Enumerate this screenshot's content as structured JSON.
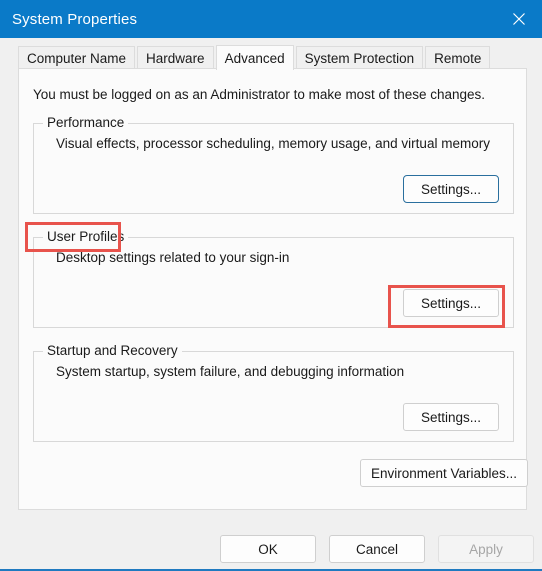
{
  "window": {
    "title": "System Properties",
    "close_icon": "close-icon"
  },
  "tabs": [
    {
      "label": "Computer Name",
      "active": false
    },
    {
      "label": "Hardware",
      "active": false
    },
    {
      "label": "Advanced",
      "active": true
    },
    {
      "label": "System Protection",
      "active": false
    },
    {
      "label": "Remote",
      "active": false
    }
  ],
  "main": {
    "admin_note": "You must be logged on as an Administrator to make most of these changes.",
    "groups": [
      {
        "legend": "Performance",
        "description": "Visual effects, processor scheduling, memory usage, and virtual memory",
        "button_label": "Settings..."
      },
      {
        "legend": "User Profiles",
        "description": "Desktop settings related to your sign-in",
        "button_label": "Settings..."
      },
      {
        "legend": "Startup and Recovery",
        "description": "System startup, system failure, and debugging information",
        "button_label": "Settings..."
      }
    ],
    "environment_variables_label": "Environment Variables..."
  },
  "footer": {
    "ok_label": "OK",
    "cancel_label": "Cancel",
    "apply_label": "Apply"
  },
  "colors": {
    "titlebar": "#0a7ac8",
    "annotation": "#e8534c",
    "focus_border": "#2a6f9e",
    "panel": "#fbfbfb",
    "dialog": "#f0f0f0"
  }
}
